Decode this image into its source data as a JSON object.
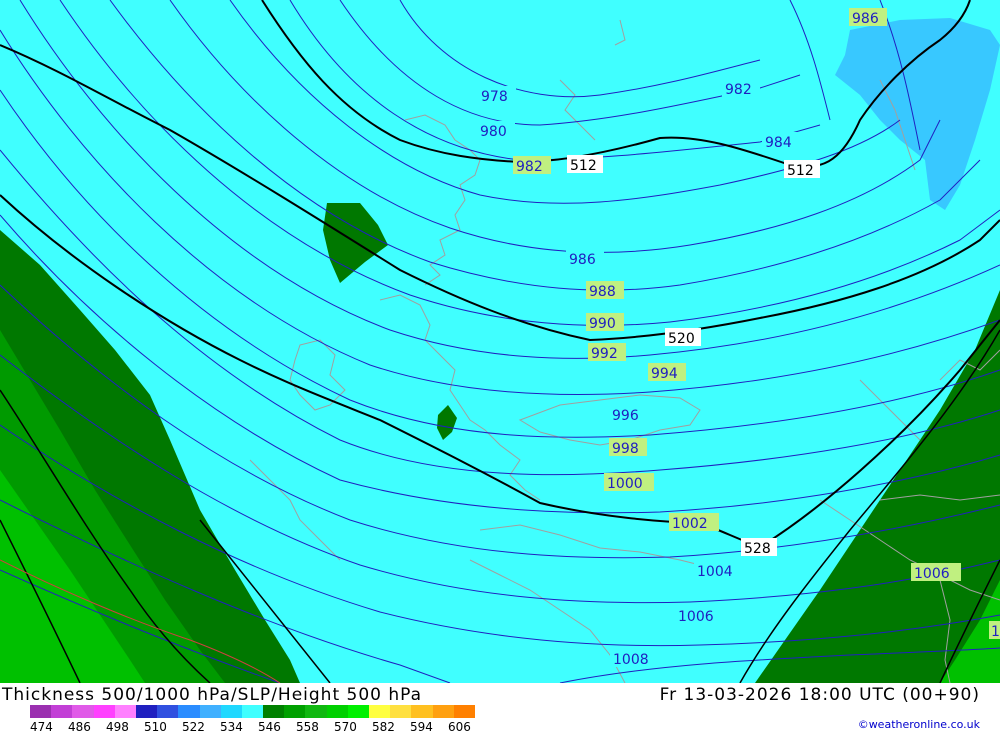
{
  "title": {
    "left": "Thickness 500/1000 hPa/SLP/Height 500 hPa",
    "right": "Fr 13-03-2026 18:00 UTC (00+90)"
  },
  "legend": {
    "ticks": [
      "474",
      "486",
      "498",
      "510",
      "522",
      "534",
      "546",
      "558",
      "570",
      "582",
      "594",
      "606"
    ],
    "colors": [
      "#9b2fb0",
      "#c23fd6",
      "#e05ae8",
      "#ff40ff",
      "#ff80ff",
      "#2020c0",
      "#3050e0",
      "#2a8cff",
      "#40b0ff",
      "#20d8ff",
      "#40ffff",
      "#008000",
      "#00a000",
      "#10b810",
      "#00d000",
      "#00f000",
      "#ffff40",
      "#ffe040",
      "#ffc020",
      "#ffa010",
      "#ff8000"
    ]
  },
  "credit": "©weatheronline.co.uk",
  "map": {
    "slp_labels": [
      "978",
      "980",
      "982",
      "982",
      "984",
      "986",
      "986",
      "988",
      "990",
      "992",
      "994",
      "996",
      "998",
      "1000",
      "1002",
      "1004",
      "1006",
      "1006",
      "1008",
      "1"
    ],
    "height_labels": [
      "512",
      "512",
      "520",
      "528"
    ],
    "colors": {
      "background_thickness": "#40ffff",
      "dark_green": "#007800",
      "mid_green": "#009a00",
      "bright_green": "#00c000",
      "light_blue": "#38c8ff",
      "isobar": "#2020c0",
      "height_line": "#000000",
      "coast": "#a0a0a0"
    }
  }
}
